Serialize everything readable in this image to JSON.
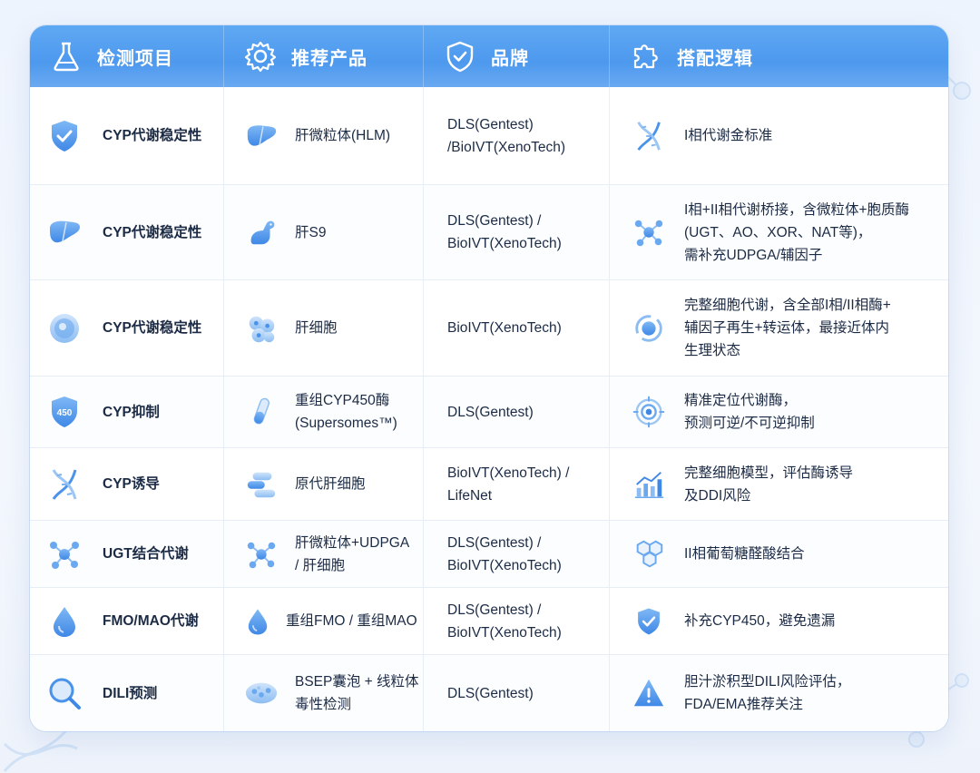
{
  "header": {
    "col1": "检测项目",
    "col2": "推荐产品",
    "col3": "品牌",
    "col4": "搭配逻辑"
  },
  "rows": [
    {
      "test": "CYP代谢稳定性",
      "test_icon": "shield-check-icon",
      "product": "肝微粒体(HLM)",
      "product_icon": "liver-icon",
      "brand": "DLS(Gentest)\n/BioIVT(XenoTech)",
      "logic": "I相代谢金标准",
      "logic_icon": "dna-icon"
    },
    {
      "test": "CYP代谢稳定性",
      "test_icon": "liver-icon",
      "product": "肝S9",
      "product_icon": "dog-icon",
      "brand": "DLS(Gentest) /\nBioIVT(XenoTech)",
      "logic": "I相+II相代谢桥接，含微粒体+胞质酶\n(UGT、AO、XOR、NAT等)，\n需补充UDPGA/辅因子",
      "logic_icon": "molecule-icon"
    },
    {
      "test": "CYP代谢稳定性",
      "test_icon": "cell-icon",
      "product": "肝细胞",
      "product_icon": "cells-icon",
      "brand": "BioIVT(XenoTech)",
      "logic": "完整细胞代谢，含全部I相/II相酶+\n辅因子再生+转运体，最接近体内\n生理状态",
      "logic_icon": "cycle-icon"
    },
    {
      "test": "CYP抑制",
      "test_icon": "shield-450-icon",
      "test_badge": "450",
      "product": "重组CYP450酶\n(Supersomes™)",
      "product_icon": "test-tube-icon",
      "brand": "DLS(Gentest)",
      "logic": "精准定位代谢酶，\n预测可逆/不可逆抑制",
      "logic_icon": "target-icon"
    },
    {
      "test": "CYP诱导",
      "test_icon": "dna-icon",
      "product": "原代肝细胞",
      "product_icon": "cell-stack-icon",
      "brand": "BioIVT(XenoTech) /\nLifeNet",
      "logic": "完整细胞模型，评估酶诱导\n及DDI风险",
      "logic_icon": "bar-chart-icon"
    },
    {
      "test": "UGT结合代谢",
      "test_icon": "molecule-icon",
      "product": "肝微粒体+UDPGA\n/ 肝细胞",
      "product_icon": "molecule-icon",
      "brand": "DLS(Gentest) /\nBioIVT(XenoTech)",
      "logic": "II相葡萄糖醛酸结合",
      "logic_icon": "hexagon-icon"
    },
    {
      "test": "FMO/MAO代谢",
      "test_icon": "droplet-icon",
      "product": "重组FMO / 重组MAO",
      "product_icon": "droplet-icon",
      "brand": "DLS(Gentest) /\nBioIVT(XenoTech)",
      "logic": "补充CYP450，避免遗漏",
      "logic_icon": "shield-check-icon"
    },
    {
      "test": "DILI预测",
      "test_icon": "magnifier-icon",
      "product": "BSEP囊泡 + 线粒体\n毒性检测",
      "product_icon": "vesicle-icon",
      "brand": "DLS(Gentest)",
      "logic": "胆汁淤积型DILI风险评估，\nFDA/EMA推荐关注",
      "logic_icon": "warning-icon"
    }
  ],
  "colors": {
    "header_top": "#5fa8f3",
    "header_bottom": "#4d99ee",
    "icon_blue": "#4a93ea",
    "icon_light": "#a9cdf6"
  }
}
